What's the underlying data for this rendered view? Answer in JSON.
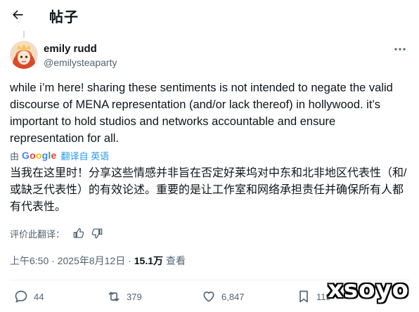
{
  "header": {
    "title": "帖子"
  },
  "tweet": {
    "display_name": "emily rudd",
    "handle": "@emilysteaparty",
    "text": "while i’m here! sharing these sentiments is not intended to negate the valid discourse of MENA representation (and/or lack thereof) in hollywood. it’s important to hold studios and networks accountable and ensure representation for all.",
    "translated_by_prefix": "由",
    "translator": "Google",
    "translate_link": "翻译自 英语",
    "translation": "当我在这里时！分享这些情感并非旨在否定好莱坞对中东和北非地区代表性（和/或缺乏代表性）的有效论述。重要的是让工作室和网络承担责任并确保所有人都有代表性。",
    "rate_label": "评价此翻译：",
    "time": "上午6:50 · 2025年8月12日 · ",
    "views_count": "15.1万",
    "views_label": "查看"
  },
  "actions": {
    "replies": "44",
    "reposts": "379",
    "likes": "6,847",
    "bookmarks": "119"
  },
  "watermark": "xsoyo",
  "colors": {
    "link": "#1d9bf0",
    "secondary": "#536471",
    "text": "#0f1419"
  },
  "icons": [
    "back-arrow-icon",
    "more-icon",
    "thumbs-up-icon",
    "thumbs-down-icon",
    "reply-icon",
    "repost-icon",
    "like-icon",
    "bookmark-icon"
  ]
}
